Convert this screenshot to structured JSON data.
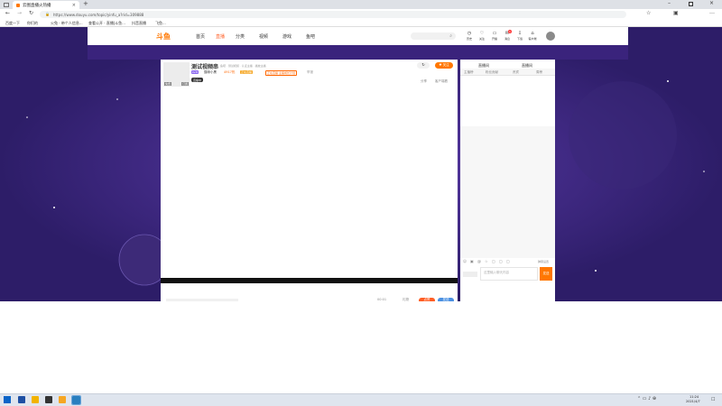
{
  "browser": {
    "tab_title": "云图直播火热播",
    "url": "https://www.douyu.com/topic/yinfu_a?rid=309888",
    "bookmarks": [
      "百度一下",
      "你们的",
      "火兔 · 带个人信息...",
      "查看公开 · 直播|斗鱼...",
      "抖音直播",
      "飞鱼..."
    ]
  },
  "site": {
    "logo": "斗鱼",
    "nav": [
      "首页",
      "直播",
      "分类",
      "视频",
      "游戏",
      "鱼吧"
    ],
    "nav_active": "直播",
    "search_placeholder": "",
    "user_icons": [
      "历史",
      "关注",
      "开播",
      "消息",
      "下载",
      "客户端"
    ],
    "badge": "1",
    "accent": "#ff7700"
  },
  "room": {
    "title": "测试视频串",
    "meta": "鱼吧 · 测试视频 · 认证主播 · 播放主播",
    "level_tag": "LV.8",
    "anchor_name": "猫咪小黑",
    "heat": "4917热",
    "follow_tag": "正在直播",
    "gift_tag": "正在直播 主播成长计划",
    "report": "举报",
    "follow_btn": "关注",
    "share": "分享",
    "client": "客户端看",
    "avatar_left": "免费",
    "avatar_right": "订阅",
    "live_status": "直播中"
  },
  "player_bar": {
    "left": "",
    "right_status": "00:01",
    "gift_btn": "点赞",
    "send_btn": "发送",
    "extra": "礼物"
  },
  "chat": {
    "tabs": [
      "直播间",
      "直播间"
    ],
    "sub_tabs": [
      "主播榜",
      "粉丝贡献",
      "贵宾",
      "周榜"
    ],
    "input_placeholder": "这里输入聊天内容",
    "send": "发送",
    "setting": "弹幕设置"
  },
  "taskbar": {
    "time": "11:24",
    "date": "2021/4/7",
    "apps": [
      "start",
      "ie",
      "edge",
      "folder",
      "chrome"
    ]
  }
}
